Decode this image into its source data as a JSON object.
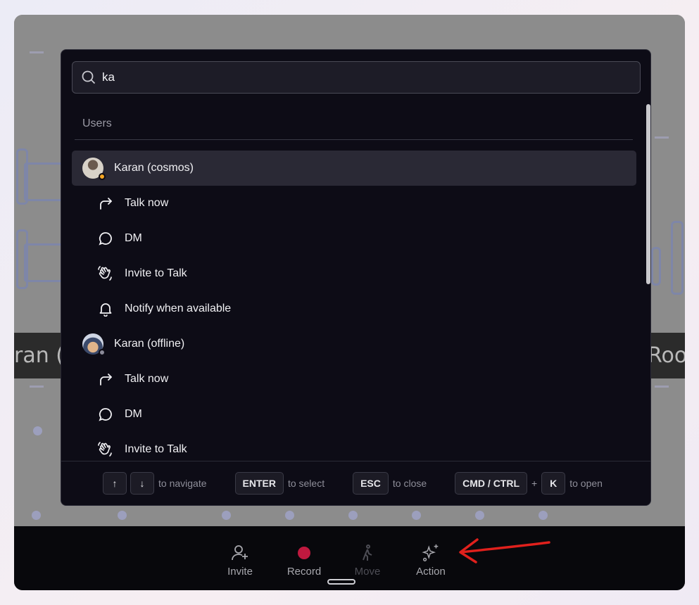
{
  "search": {
    "value": "ka",
    "placeholder": ""
  },
  "section": {
    "label": "Users"
  },
  "users": [
    {
      "name": "Karan (cosmos)",
      "status_color": "#f5a623",
      "actions": [
        {
          "label": "Talk now",
          "icon": "share-arrow-icon"
        },
        {
          "label": "DM",
          "icon": "chat-bubble-icon"
        },
        {
          "label": "Invite to Talk",
          "icon": "wave-hand-icon"
        },
        {
          "label": "Notify when available",
          "icon": "bell-icon"
        }
      ]
    },
    {
      "name": "Karan (offline)",
      "status_color": "#8b8b99",
      "actions": [
        {
          "label": "Talk now",
          "icon": "share-arrow-icon"
        },
        {
          "label": "DM",
          "icon": "chat-bubble-icon"
        },
        {
          "label": "Invite to Talk",
          "icon": "wave-hand-icon"
        }
      ]
    }
  ],
  "footer": {
    "up_key": "↑",
    "down_key": "↓",
    "navigate": "to navigate",
    "enter_key": "ENTER",
    "select": "to select",
    "esc_key": "ESC",
    "close": "to close",
    "cmd_key": "CMD / CTRL",
    "plus": "+",
    "k_key": "K",
    "open": "to open"
  },
  "background": {
    "banner_left": "ran (c",
    "banner_right": "Roor"
  },
  "bottombar": {
    "invite": "Invite",
    "record": "Record",
    "move": "Move",
    "action": "Action",
    "record_color": "#c0193f"
  },
  "annotation_color": "#e0201c"
}
